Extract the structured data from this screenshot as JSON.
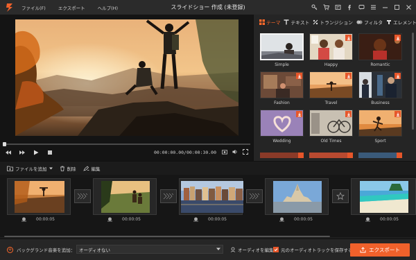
{
  "app": {
    "title": "スライドショー 作成 (未登録)",
    "menu": [
      "ファイル(F)",
      "エクスポート",
      "ヘルプ(H)"
    ],
    "accent_color": "#f0612b",
    "title_icons": [
      "key-icon",
      "cart-icon",
      "register-icon",
      "facebook-icon",
      "feedback-icon",
      "menu-icon",
      "minimize-icon",
      "maximize-icon",
      "close-icon"
    ]
  },
  "player": {
    "timecode": "00:00:00.00/00:00:30.00",
    "progress": 0.01
  },
  "tabs": [
    {
      "label": "テーマ",
      "icon": "theme-grid-icon",
      "active": true
    },
    {
      "label": "テキスト",
      "icon": "text-icon",
      "active": false
    },
    {
      "label": "トランジション",
      "icon": "transition-icon",
      "active": false
    },
    {
      "label": "フィルタ",
      "icon": "filter-icon",
      "active": false
    },
    {
      "label": "エレメント",
      "icon": "element-icon",
      "active": false
    }
  ],
  "themes": [
    {
      "label": "Simple",
      "selected": true,
      "download": false
    },
    {
      "label": "Happy",
      "selected": false,
      "download": true
    },
    {
      "label": "Romantic",
      "selected": false,
      "download": true
    },
    {
      "label": "Fashion",
      "selected": false,
      "download": true
    },
    {
      "label": "Travel",
      "selected": false,
      "download": true
    },
    {
      "label": "Business",
      "selected": false,
      "download": true
    },
    {
      "label": "Wedding",
      "selected": false,
      "download": true
    },
    {
      "label": "Old Times",
      "selected": false,
      "download": true
    },
    {
      "label": "Sport",
      "selected": false,
      "download": true
    }
  ],
  "toolbar": {
    "add_file": "ファイルを追加",
    "delete": "削除",
    "edit": "編集"
  },
  "timeline": {
    "clips": [
      {
        "duration": "00:00:05"
      },
      {
        "duration": "00:00:05"
      },
      {
        "duration": "00:00:05"
      },
      {
        "duration": "00:00:05"
      },
      {
        "duration": "00:00:05"
      }
    ]
  },
  "bottom": {
    "add_bgm": "バックグランド音楽を追加：",
    "audio_select": "オーディオない",
    "audio_edit": "オーディオを編集",
    "keep_original": "元のオーディオトラックを保存する",
    "keep_original_checked": true,
    "export": "エクスポート"
  }
}
